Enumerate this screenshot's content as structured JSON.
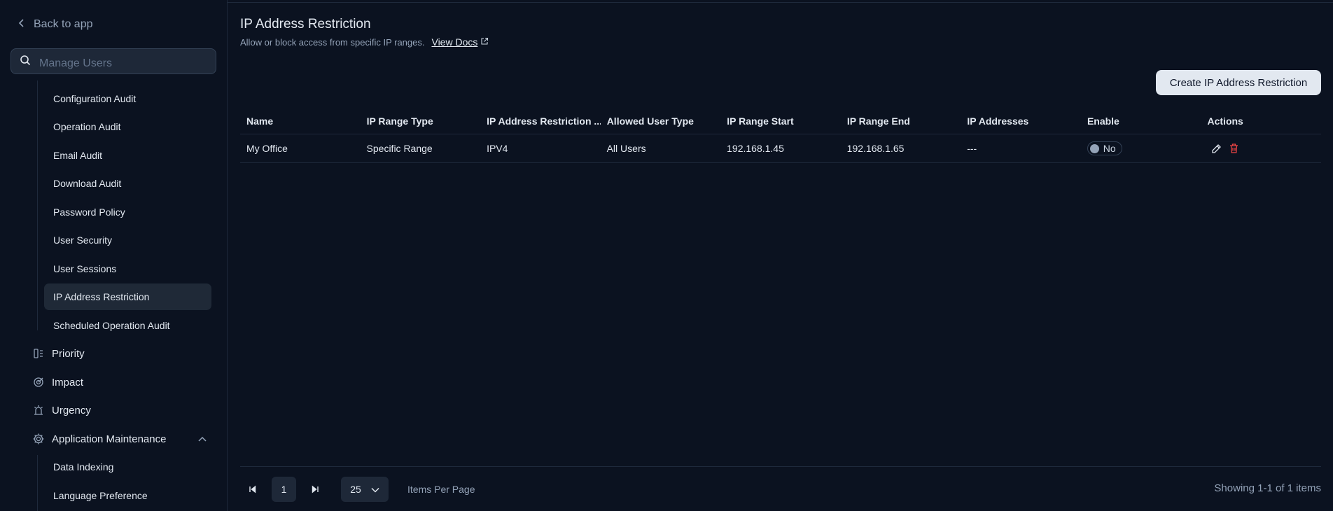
{
  "sidebar": {
    "back_label": "Back to app",
    "search_placeholder": "Manage Users",
    "sub_items_top": [
      "Configuration Audit",
      "Operation Audit",
      "Email Audit",
      "Download Audit",
      "Password Policy",
      "User Security",
      "User Sessions",
      "IP Address Restriction",
      "Scheduled Operation Audit"
    ],
    "active_item": "IP Address Restriction",
    "nav_items": [
      {
        "label": "Priority",
        "icon": "priority-icon"
      },
      {
        "label": "Impact",
        "icon": "target-icon"
      },
      {
        "label": "Urgency",
        "icon": "alarm-icon"
      },
      {
        "label": "Application Maintenance",
        "icon": "gear-icon"
      }
    ],
    "sub_items_bottom": [
      "Data Indexing",
      "Language Preference"
    ]
  },
  "header": {
    "title": "IP Address Restriction",
    "subtitle": "Allow or block access from specific IP ranges.",
    "docs_label": "View Docs"
  },
  "create_button_label": "Create IP Address Restriction",
  "table": {
    "columns": [
      "Name",
      "IP Range Type",
      "IP Address Restriction ...",
      "Allowed User Type",
      "IP Range Start",
      "IP Range End",
      "IP Addresses",
      "Enable",
      "Actions"
    ],
    "rows": [
      {
        "name": "My Office",
        "range_type": "Specific Range",
        "restriction": "IPV4",
        "user_type": "All Users",
        "range_start": "192.168.1.45",
        "range_end": "192.168.1.65",
        "addresses": "---",
        "enable_label": "No"
      }
    ]
  },
  "pagination": {
    "current_page": "1",
    "page_size": "25",
    "items_per_page_label": "Items Per Page",
    "showing": "Showing 1-1 of 1 items"
  },
  "colors": {
    "background": "#0b1220",
    "active_bg": "#1f2937",
    "delete": "#ef4444"
  }
}
